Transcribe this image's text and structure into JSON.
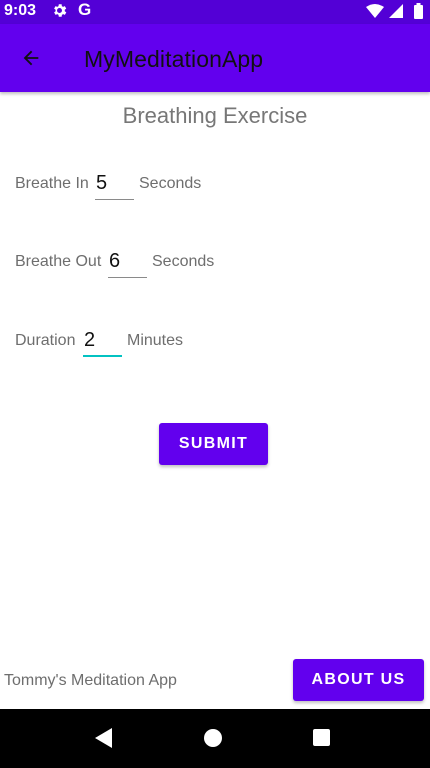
{
  "status_bar": {
    "time": "9:03",
    "g_label": "G",
    "icons": [
      "gear-icon",
      "google-icon",
      "wifi-icon",
      "signal-icon",
      "battery-icon"
    ]
  },
  "app_bar": {
    "title": "MyMeditationApp",
    "back_icon": "arrow-back-icon"
  },
  "main": {
    "title": "Breathing Exercise",
    "rows": [
      {
        "label": "Breathe In",
        "value": "5",
        "unit": "Seconds"
      },
      {
        "label": "Breathe Out",
        "value": "6",
        "unit": "Seconds"
      },
      {
        "label": "Duration",
        "value": "2",
        "unit": "Minutes"
      }
    ],
    "submit_label": "SUBMIT"
  },
  "footer": {
    "text": "Tommy's Meditation App",
    "about_label": "ABOUT US"
  },
  "nav_bar": {
    "icons": [
      "nav-back-icon",
      "nav-home-icon",
      "nav-recents-icon"
    ]
  },
  "colors": {
    "status_bar": "#5300d6",
    "primary": "#6200ee",
    "focus_accent": "#03c2c2",
    "secondary_text": "#6e6e6e"
  }
}
